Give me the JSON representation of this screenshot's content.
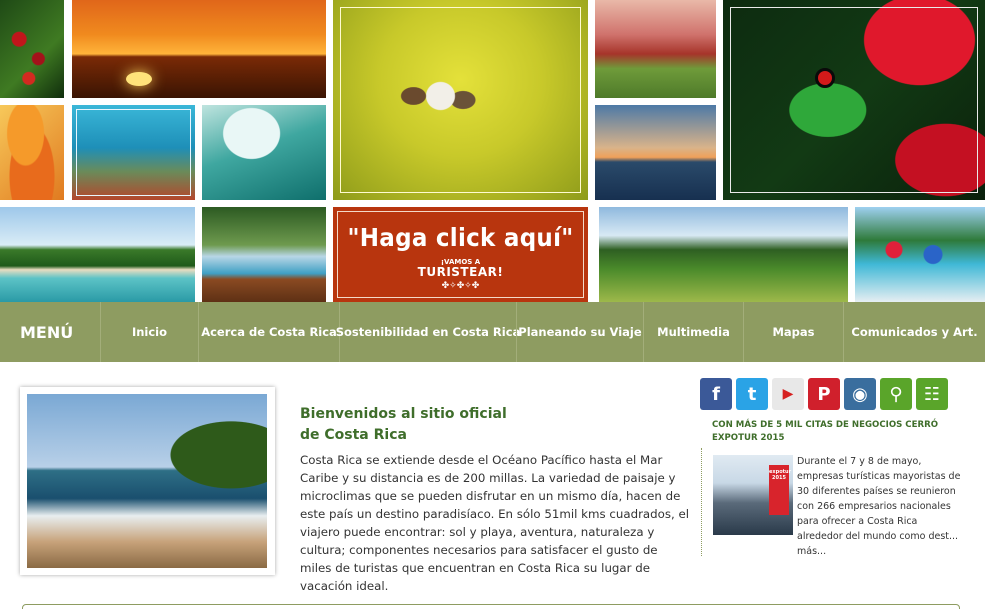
{
  "banner": {
    "cta_title": "\"Haga click aquí\"",
    "cta_small": "¡VAMOS A",
    "cta_big": "TURISTEAR!",
    "cta_ornament": "✤✧✤✧✤"
  },
  "menu": {
    "label": "MENÚ",
    "items": [
      "Inicio",
      "Acerca de Costa Rica",
      "Sostenibilidad en Costa Rica",
      "Planeando su Viaje",
      "Multimedia",
      "Mapas",
      "Comunicados y Art."
    ]
  },
  "welcome": {
    "line1": "Bienvenidos al sitio oficial",
    "line2": "de Costa Rica",
    "body": "Costa Rica se extiende desde el Océano Pacífico hasta el Mar Caribe y su distancia es de 200 millas. La variedad de paisaje y microclimas que se pueden disfrutar en un mismo día, hacen de este país un destino paradisíaco. En sólo 51mil kms cuadrados, el viajero puede encontrar: sol y playa, aventura, naturaleza y cultura; componentes necesarios para satisfacer el gusto de miles de turistas que encuentran en Costa Rica su lugar de vacación ideal."
  },
  "social": {
    "icons": [
      {
        "name": "facebook-icon",
        "glyph": "f",
        "color": "#3b5998"
      },
      {
        "name": "twitter-icon",
        "glyph": "t",
        "color": "#2aa3e6"
      },
      {
        "name": "youtube-icon",
        "glyph": "▶",
        "color": "#e8e8e8",
        "glyph_color": "#d62020"
      },
      {
        "name": "pinterest-icon",
        "glyph": "P",
        "color": "#d0202c"
      },
      {
        "name": "instagram-icon",
        "glyph": "◉",
        "color": "#3a6e9e"
      },
      {
        "name": "search-icon",
        "glyph": "⚲",
        "color": "#5aa52a"
      },
      {
        "name": "sitemap-icon",
        "glyph": "☷",
        "color": "#5aa52a"
      }
    ]
  },
  "news": {
    "title": "CON MÁS DE 5 MIL CITAS DE NEGOCIOS CERRÓ EXPOTUR 2015",
    "thumb_label": "expotur 2015",
    "body": "Durante el 7 y 8 de mayo, empresas turísticas mayoristas de 30 diferentes países se reunieron con 266 empresarios nacionales para ofrecer a Costa Rica alrededor del mundo como dest...",
    "more": "más..."
  },
  "colors": {
    "menu_bg": "#8e9c61",
    "heading_green": "#3f6e2b",
    "cta_bg": "#b8350e"
  }
}
